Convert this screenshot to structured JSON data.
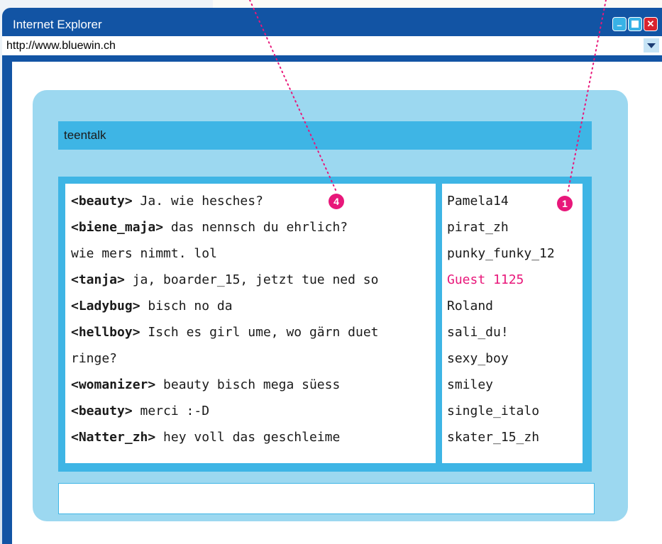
{
  "window": {
    "title": "Internet Explorer",
    "url": "http://www.bluewin.ch"
  },
  "chat": {
    "room_title": "teentalk",
    "messages": [
      {
        "nick": "<beauty>",
        "text": " Ja. wie hesches?"
      },
      {
        "nick": "<biene_maja>",
        "text": " das nennsch du ehrlich?"
      },
      {
        "nick": "",
        "text": "wie mers nimmt. lol"
      },
      {
        "nick": "<tanja>",
        "text": " ja, boarder_15, jetzt tue ned so"
      },
      {
        "nick": "<Ladybug>",
        "text": " bisch no da"
      },
      {
        "nick": "<hellboy>",
        "text": " Isch es girl ume, wo gärn duet"
      },
      {
        "nick": "",
        "text": "ringe?"
      },
      {
        "nick": "<womanizer>",
        "text": " beauty bisch mega süess"
      },
      {
        "nick": "<beauty>",
        "text": " merci :-D"
      },
      {
        "nick": "<Natter_zh>",
        "text": " hey voll das geschleime"
      }
    ],
    "users": [
      "Pamela14",
      "pirat_zh",
      "punky_funky_12",
      "Guest 1125",
      "Roland",
      "sali_du!",
      "sexy_boy",
      "smiley",
      "single_italo",
      "skater_15_zh"
    ],
    "input_value": ""
  },
  "markers": {
    "messages": "4",
    "users": "1"
  },
  "colors": {
    "window_frame": "#1254a4",
    "panel": "#9cd8f0",
    "accent": "#3eb5e5",
    "highlight": "#e8177a"
  }
}
